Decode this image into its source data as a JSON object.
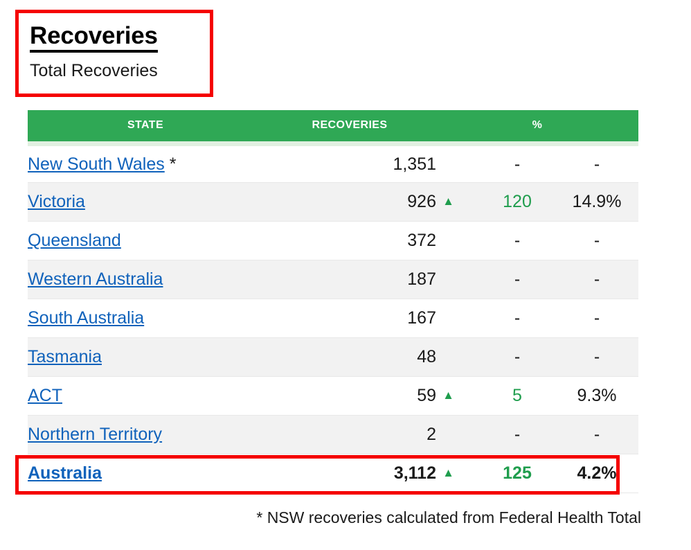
{
  "header": {
    "title": "Recoveries",
    "subtitle": "Total Recoveries"
  },
  "table": {
    "columns": {
      "state": "STATE",
      "recoveries": "RECOVERIES",
      "percent": "%"
    },
    "rows": [
      {
        "state": "New South Wales",
        "state_note": " *",
        "recoveries": "1,351",
        "change_icon": "",
        "change": "-",
        "percent": "-",
        "is_total": false
      },
      {
        "state": "Victoria",
        "state_note": "",
        "recoveries": "926",
        "change_icon": "▲",
        "change": "120",
        "percent": "14.9%",
        "is_total": false
      },
      {
        "state": "Queensland",
        "state_note": "",
        "recoveries": "372",
        "change_icon": "",
        "change": "-",
        "percent": "-",
        "is_total": false
      },
      {
        "state": "Western Australia",
        "state_note": "",
        "recoveries": "187",
        "change_icon": "",
        "change": "-",
        "percent": "-",
        "is_total": false
      },
      {
        "state": "South Australia",
        "state_note": "",
        "recoveries": "167",
        "change_icon": "",
        "change": "-",
        "percent": "-",
        "is_total": false
      },
      {
        "state": "Tasmania",
        "state_note": "",
        "recoveries": "48",
        "change_icon": "",
        "change": "-",
        "percent": "-",
        "is_total": false
      },
      {
        "state": "ACT",
        "state_note": "",
        "recoveries": "59",
        "change_icon": "▲",
        "change": "5",
        "percent": "9.3%",
        "is_total": false
      },
      {
        "state": "Northern Territory",
        "state_note": "",
        "recoveries": "2",
        "change_icon": "",
        "change": "-",
        "percent": "-",
        "is_total": false
      },
      {
        "state": "Australia",
        "state_note": "",
        "recoveries": "3,112",
        "change_icon": "▲",
        "change": "125",
        "percent": "4.2%",
        "is_total": true
      }
    ]
  },
  "footnote": "* NSW recoveries calculated from Federal Health Total",
  "colors": {
    "header_green": "#2fa855",
    "header_underline": "#e1f0e1",
    "link_blue": "#1062bb",
    "increase_green": "#1f9d4d",
    "highlight_red": "#f50000",
    "row_alt": "#f2f2f2"
  }
}
